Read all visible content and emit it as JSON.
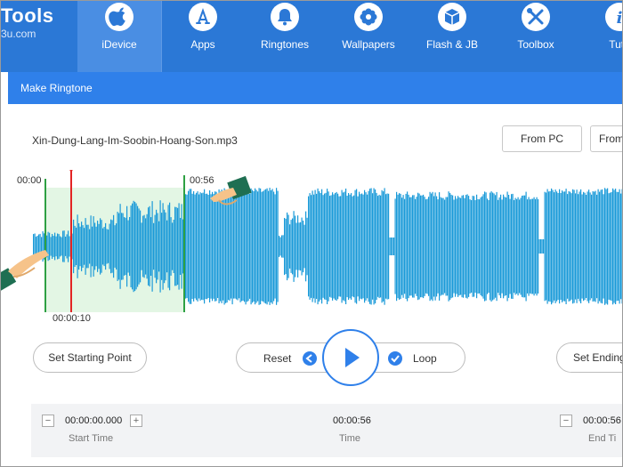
{
  "app": {
    "logo_title": "Tools",
    "logo_sub": "3u.com"
  },
  "nav": [
    {
      "label": "iDevice",
      "icon": "apple-icon",
      "active": true
    },
    {
      "label": "Apps",
      "icon": "app-store-icon",
      "active": false
    },
    {
      "label": "Ringtones",
      "icon": "bell-icon",
      "active": false
    },
    {
      "label": "Wallpapers",
      "icon": "flower-icon",
      "active": false
    },
    {
      "label": "Flash & JB",
      "icon": "box-icon",
      "active": false
    },
    {
      "label": "Toolbox",
      "icon": "wrench-screwdriver-icon",
      "active": false
    },
    {
      "label": "Tuto",
      "icon": "info-icon",
      "active": false
    }
  ],
  "dialog": {
    "title": "Make Ringtone",
    "filename": "Xin-Dung-Lang-Im-Soobin-Hoang-Son.mp3",
    "from_pc_label": "From PC",
    "from_other_label": "From"
  },
  "waveform": {
    "start_label": "00:00",
    "end_marker_label": "00:56",
    "playhead_label": "00:00:10",
    "colors": {
      "wave": "#1a9ad8",
      "selection": "#e3f6e4",
      "marker": "#2ea043",
      "playhead": "#e32424"
    }
  },
  "controls": {
    "set_start_label": "Set Starting Point",
    "reset_label": "Reset",
    "loop_label": "Loop",
    "set_end_label": "Set Ending"
  },
  "times": {
    "start_value": "00:00:00.000",
    "start_caption": "Start Time",
    "time_value": "00:00:56",
    "time_caption": "Time",
    "end_value": "00:00:56",
    "end_caption": "End Ti"
  },
  "theme": {
    "nav_bg": "#2b78d6",
    "accent": "#2f80ea"
  }
}
